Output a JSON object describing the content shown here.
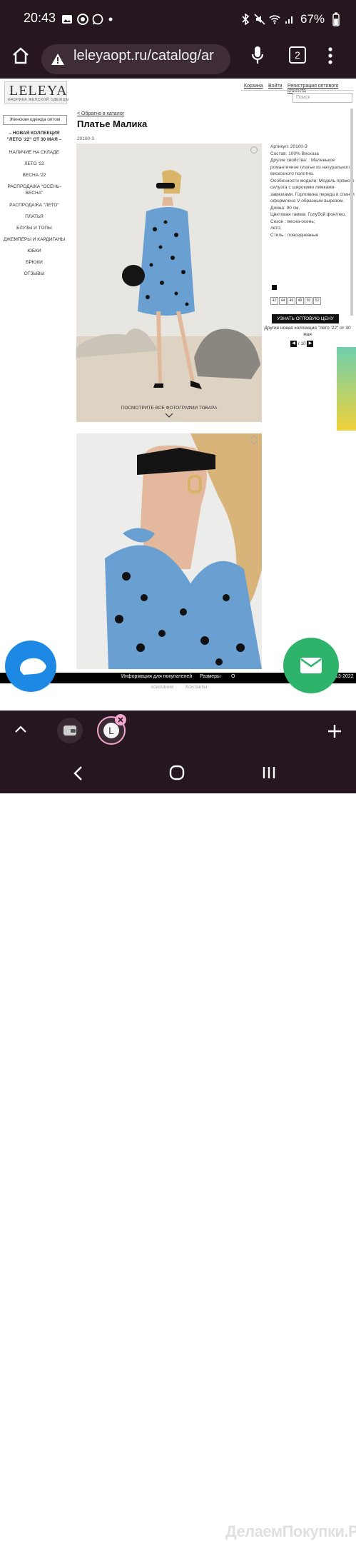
{
  "status_bar": {
    "time": "20:43",
    "battery": "67%"
  },
  "browser": {
    "url": "leleyaopt.ru/catalog/ar",
    "tab_count": "2"
  },
  "header": {
    "logo_big": "LELEYA",
    "logo_small": "ФАБРИКА ЖЕНСКОЙ ОДЕЖДЫ",
    "links": [
      "Корзина",
      "Войти",
      "Регистрация оптового клиента"
    ],
    "search_placeholder": "Поиск"
  },
  "sidebar": {
    "category_button": "Женская одежда оптом",
    "items": [
      "– НОВАЯ КОЛЛЕКЦИЯ \"ЛЕТО '22\" ОТ 30 МАЯ –",
      "НАЛИЧИЕ НА СКЛАДЕ",
      "ЛЕТО '22",
      "ВЕСНА '22",
      "РАСПРОДАЖА \"ОСЕНЬ-ВЕСНА\"",
      "РАСПРОДАЖА \"ЛЕТО\"",
      "ПЛАТЬЯ",
      "БЛУЗЫ И ТОПЫ",
      "ДЖЕМПЕРЫ И КАРДИГАНЫ",
      "ЮБКИ",
      "БРЮКИ",
      "ОТЗЫВЫ"
    ]
  },
  "product": {
    "back_link": "< Обратно в каталог",
    "title": "Платье Малика",
    "sku": "20100-3",
    "all_photos": "ПОСМОТРИТЕ ВСЕ ФОТОГРАФИИ ТОВАРА",
    "info": [
      "Артикул: 20100-3",
      "Состав: 100% Вискоза",
      "Другие свойства: : Маленькое романтичное платье из натурального вискозного полотна.",
      "Особенности модели: Модель прямого силуэта с широкими лямками-завязками. Горловина переда и спинки оформлена V-образным вырезом.",
      "Длина: 90 см.",
      "Цветовая гамма: Голубой фон/лео.",
      "Сезон : весна-осень;",
      "лето;",
      "Стиль : повседневные"
    ],
    "sizes": [
      "42",
      "44",
      "46",
      "48",
      "50",
      "52"
    ],
    "wholesale_button": "УЗНАТЬ ОПТОВУЮ ЦЕНУ",
    "other_text": "Другие новая коллекция \"лето '22\" от 30 мая",
    "pager": "/ 10",
    "swatch_color": "#000000"
  },
  "footer": {
    "items": [
      "Информация для покупателей",
      "Размеры",
      "О",
      "13-2022"
    ],
    "items2": [
      "компании",
      "Контакты"
    ]
  },
  "colors": {
    "chrome_bg": "#26161f",
    "fab_left": "#1e88e5",
    "fab_right": "#2db36a"
  },
  "watermark": "ДелаемПокупки.Ру"
}
